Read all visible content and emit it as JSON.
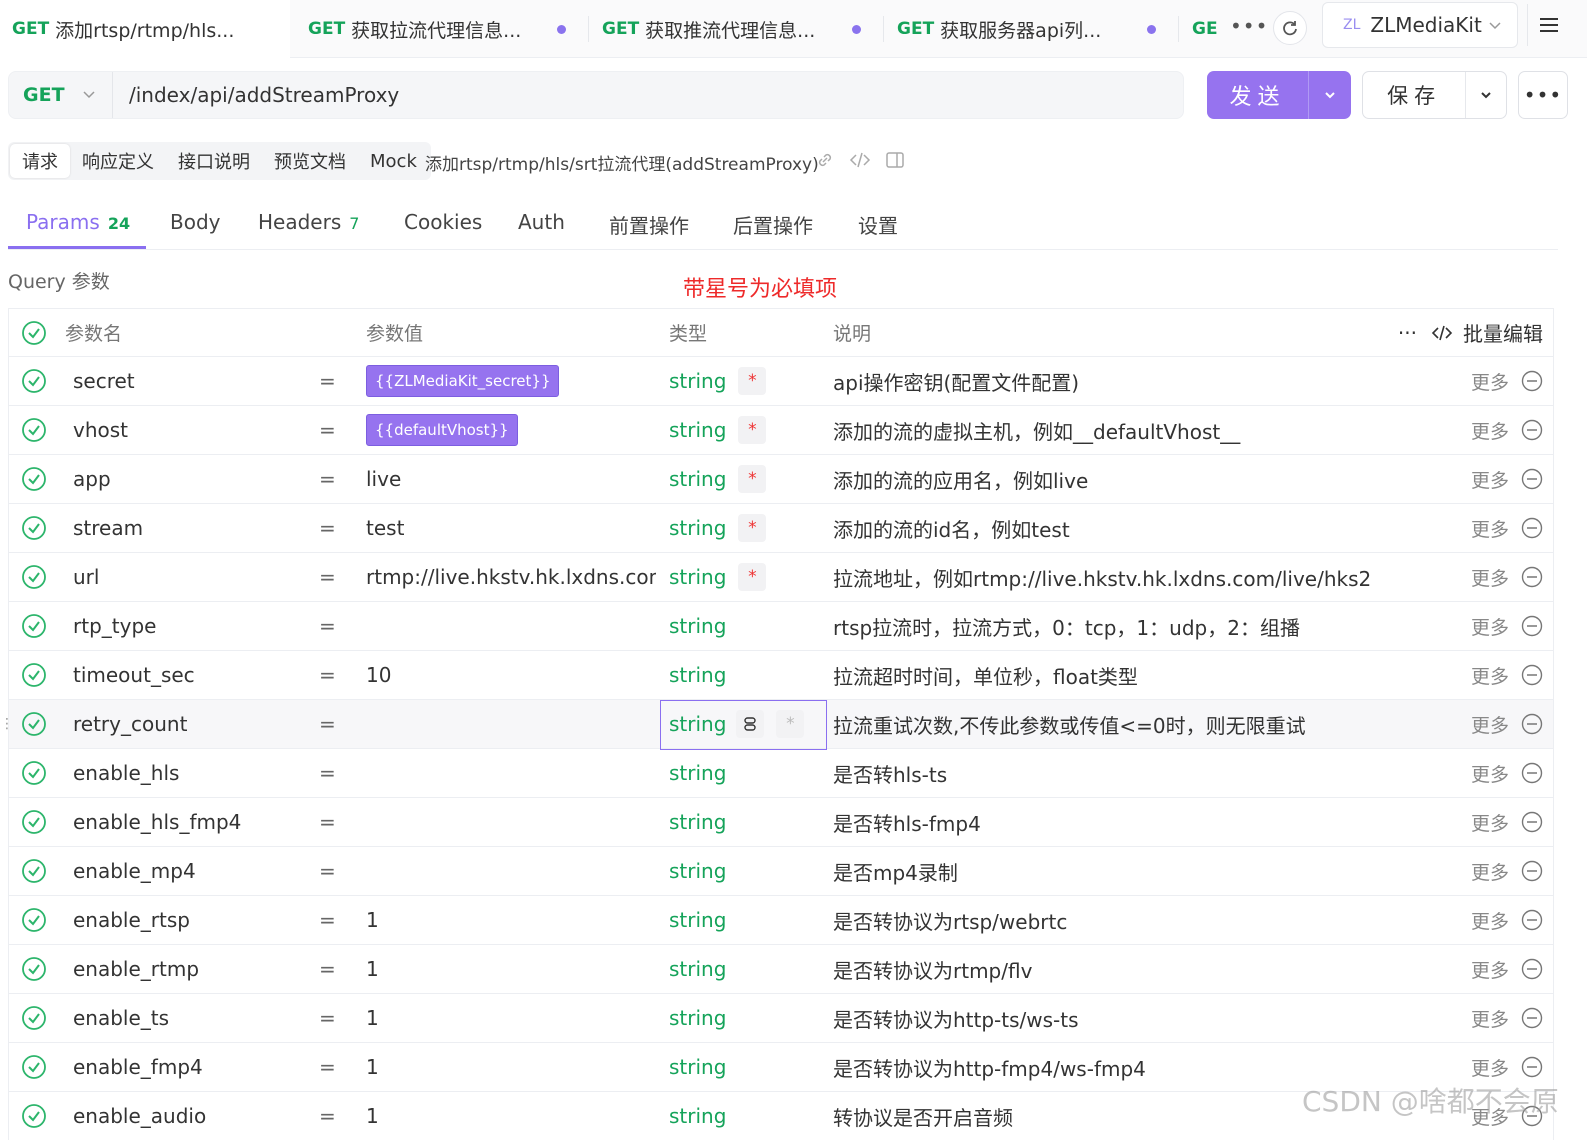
{
  "request_tabs": [
    {
      "method": "GET",
      "title": "添加rtsp/rtmp/hls...",
      "active": true,
      "dot": false
    },
    {
      "method": "GET",
      "title": "获取拉流代理信息...",
      "active": false,
      "dot": true
    },
    {
      "method": "GET",
      "title": "获取推流代理信息...",
      "active": false,
      "dot": true
    },
    {
      "method": "GET",
      "title": "获取服务器api列...",
      "active": false,
      "dot": true
    },
    {
      "method": "GE",
      "title": "",
      "active": false,
      "dot": false
    }
  ],
  "topbar": {
    "more": "•••",
    "env_badge": "ZL",
    "env_name": "ZLMediaKit"
  },
  "url_bar": {
    "method": "GET",
    "path": "/index/api/addStreamProxy",
    "send_label": "发送",
    "save_label": "保存",
    "more_label": "•••"
  },
  "sub_tabs": [
    "请求",
    "响应定义",
    "接口说明",
    "预览文档",
    "Mock"
  ],
  "api_name": "添加rtsp/rtmp/hls/srt拉流代理(addStreamProxy)",
  "param_tabs": [
    {
      "label": "Params",
      "count": "24"
    },
    {
      "label": "Body",
      "count": ""
    },
    {
      "label": "Headers",
      "count": "7"
    },
    {
      "label": "Cookies",
      "count": ""
    },
    {
      "label": "Auth",
      "count": ""
    },
    {
      "label": "前置操作",
      "count": ""
    },
    {
      "label": "后置操作",
      "count": ""
    },
    {
      "label": "设置",
      "count": ""
    }
  ],
  "query_label": "Query 参数",
  "required_note": "带星号为必填项",
  "table_head": {
    "name": "参数名",
    "value": "参数值",
    "type": "类型",
    "desc": "说明",
    "more": "···",
    "bulk_edit": "批量编辑"
  },
  "more_label": "更多",
  "eq": "=",
  "params": [
    {
      "name": "secret",
      "value": "{{ZLMediaKit_secret}}",
      "value_is_var": true,
      "type": "string",
      "required": true,
      "desc": "api操作密钥(配置文件配置)"
    },
    {
      "name": "vhost",
      "value": "{{defaultVhost}}",
      "value_is_var": true,
      "type": "string",
      "required": true,
      "desc": "添加的流的虚拟主机，例如__defaultVhost__"
    },
    {
      "name": "app",
      "value": "live",
      "value_is_var": false,
      "type": "string",
      "required": true,
      "desc": "添加的流的应用名，例如live"
    },
    {
      "name": "stream",
      "value": "test",
      "value_is_var": false,
      "type": "string",
      "required": true,
      "desc": "添加的流的id名，例如test"
    },
    {
      "name": "url",
      "value": "rtmp://live.hkstv.hk.lxdns.com/li",
      "value_is_var": false,
      "type": "string",
      "required": true,
      "desc": "拉流地址，例如rtmp://live.hkstv.hk.lxdns.com/live/hks2"
    },
    {
      "name": "rtp_type",
      "value": "",
      "value_is_var": false,
      "type": "string",
      "required": false,
      "desc": "rtsp拉流时，拉流方式，0：tcp，1：udp，2：组播"
    },
    {
      "name": "timeout_sec",
      "value": "10",
      "value_is_var": false,
      "type": "string",
      "required": false,
      "desc": "拉流超时时间，单位秒，float类型"
    },
    {
      "name": "retry_count",
      "value": "",
      "value_is_var": false,
      "type": "string",
      "required": false,
      "focused": true,
      "desc": "拉流重试次数,不传此参数或传值<=0时，则无限重试"
    },
    {
      "name": "enable_hls",
      "value": "",
      "value_is_var": false,
      "type": "string",
      "required": false,
      "desc": "是否转hls-ts"
    },
    {
      "name": "enable_hls_fmp4",
      "value": "",
      "value_is_var": false,
      "type": "string",
      "required": false,
      "desc": "是否转hls-fmp4"
    },
    {
      "name": "enable_mp4",
      "value": "",
      "value_is_var": false,
      "type": "string",
      "required": false,
      "desc": "是否mp4录制"
    },
    {
      "name": "enable_rtsp",
      "value": "1",
      "value_is_var": false,
      "type": "string",
      "required": false,
      "desc": "是否转协议为rtsp/webrtc"
    },
    {
      "name": "enable_rtmp",
      "value": "1",
      "value_is_var": false,
      "type": "string",
      "required": false,
      "desc": "是否转协议为rtmp/flv"
    },
    {
      "name": "enable_ts",
      "value": "1",
      "value_is_var": false,
      "type": "string",
      "required": false,
      "desc": "是否转协议为http-ts/ws-ts"
    },
    {
      "name": "enable_fmp4",
      "value": "1",
      "value_is_var": false,
      "type": "string",
      "required": false,
      "desc": "是否转协议为http-fmp4/ws-fmp4"
    },
    {
      "name": "enable_audio",
      "value": "1",
      "value_is_var": false,
      "type": "string",
      "required": false,
      "desc": "转协议是否开启音频"
    }
  ],
  "star": "*",
  "watermark": "CSDN @啥都不会原",
  "colors": {
    "accent": "#8a6ff0",
    "send_button": "#9673ef",
    "method_get": "#15a35a",
    "required_note": "#ee2a2a"
  }
}
